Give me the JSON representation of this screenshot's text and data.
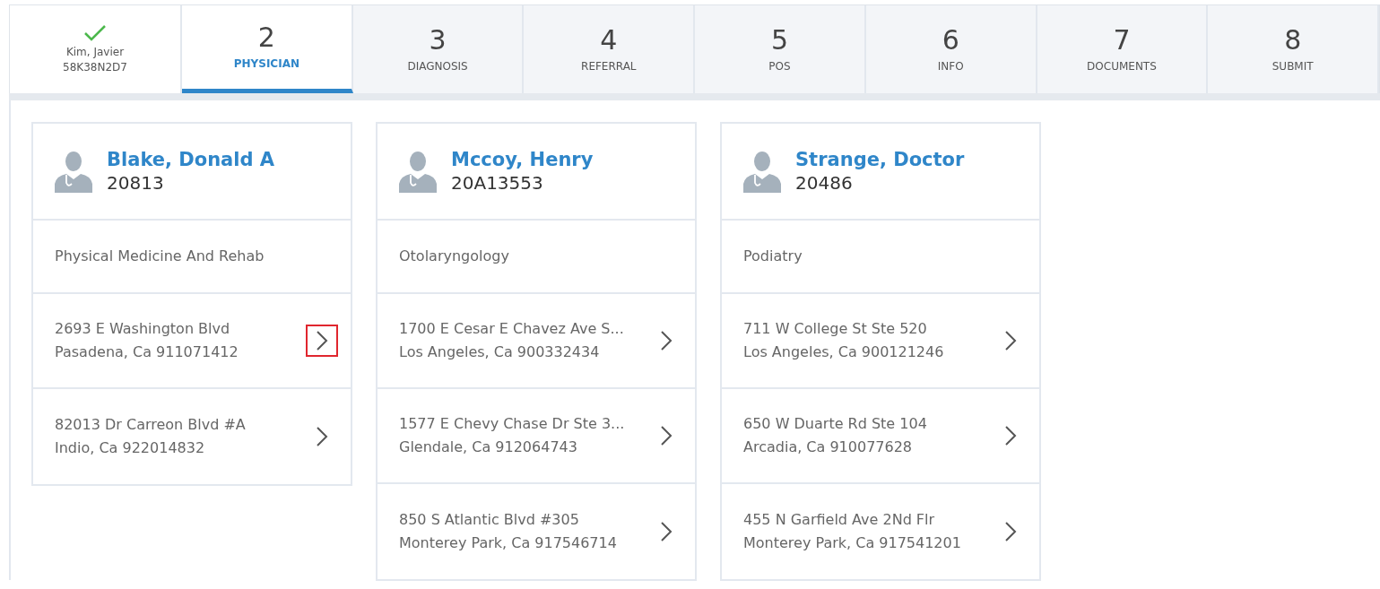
{
  "patient_tab": {
    "name": "Kim, Javier",
    "id": "58K38N2D7",
    "completed": true
  },
  "steps": [
    {
      "number": "2",
      "label": "PHYSICIAN",
      "selected": true
    },
    {
      "number": "3",
      "label": "DIAGNOSIS",
      "selected": false
    },
    {
      "number": "4",
      "label": "REFERRAL",
      "selected": false
    },
    {
      "number": "5",
      "label": "POS",
      "selected": false
    },
    {
      "number": "6",
      "label": "INFO",
      "selected": false
    },
    {
      "number": "7",
      "label": "DOCUMENTS",
      "selected": false
    },
    {
      "number": "8",
      "label": "SUBMIT",
      "selected": false
    }
  ],
  "physicians": [
    {
      "name": "Blake, Donald A",
      "id": "20813",
      "specialty": "Physical Medicine And Rehab",
      "addresses": [
        {
          "line1": "2693 E Washington Blvd",
          "line2": "Pasadena, Ca 911071412",
          "highlighted": true
        },
        {
          "line1": "82013 Dr Carreon Blvd #A",
          "line2": "Indio, Ca 922014832",
          "highlighted": false
        }
      ]
    },
    {
      "name": "Mccoy, Henry",
      "id": "20A13553",
      "specialty": "Otolaryngology",
      "addresses": [
        {
          "line1": "1700 E Cesar E Chavez Ave S...",
          "line2": "Los Angeles, Ca 900332434",
          "highlighted": false
        },
        {
          "line1": "1577 E Chevy Chase Dr Ste 3...",
          "line2": "Glendale, Ca 912064743",
          "highlighted": false
        },
        {
          "line1": "850 S Atlantic Blvd #305",
          "line2": "Monterey Park, Ca 917546714",
          "highlighted": false
        }
      ]
    },
    {
      "name": "Strange, Doctor",
      "id": "20486",
      "specialty": "Podiatry",
      "addresses": [
        {
          "line1": "711 W College St Ste 520",
          "line2": "Los Angeles, Ca 900121246",
          "highlighted": false
        },
        {
          "line1": "650 W Duarte Rd Ste 104",
          "line2": "Arcadia, Ca 910077628",
          "highlighted": false
        },
        {
          "line1": "455 N Garfield Ave 2Nd Flr",
          "line2": "Monterey Park, Ca 917541201",
          "highlighted": false
        }
      ]
    }
  ]
}
